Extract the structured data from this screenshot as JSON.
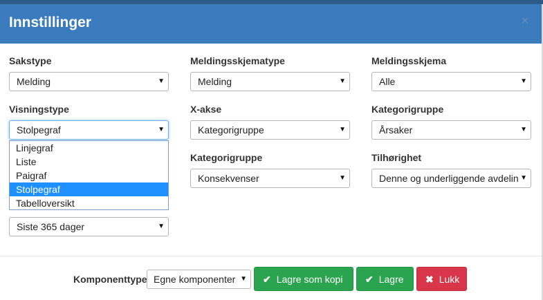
{
  "header": {
    "title": "Innstillinger",
    "close_label": "×"
  },
  "fields": {
    "sakstype": {
      "label": "Sakstype",
      "value": "Melding"
    },
    "meldingsskjematype": {
      "label": "Meldingsskjematype",
      "value": "Melding"
    },
    "meldingsskjema": {
      "label": "Meldingsskjema",
      "value": "Alle"
    },
    "visningstype": {
      "label": "Visningstype",
      "value": "Stolpegraf",
      "options": [
        "Linjegraf",
        "Liste",
        "Paigraf",
        "Stolpegraf",
        "Tabelloversikt"
      ]
    },
    "xakse": {
      "label": "X-akse",
      "value": "Kategorigruppe"
    },
    "kategorigruppe1": {
      "label": "Kategorigruppe",
      "value": "Årsaker"
    },
    "kategorigruppe2": {
      "label": "Kategorigruppe",
      "value": "Konsekvenser"
    },
    "tilhorighet": {
      "label": "Tilhørighet",
      "value": "Denne og underliggende avdelin"
    },
    "periode": {
      "value": "Siste 365 dager"
    }
  },
  "footer": {
    "komponenttype_label": "Komponenttype",
    "komponenttype_value": "Egne komponenter",
    "save_copy_label": "Lagre som kopi",
    "save_label": "Lagre",
    "close_label": "Lukk"
  },
  "icons": {
    "caret": "▼",
    "check": "✔",
    "cross": "✖"
  },
  "colors": {
    "header": "#3a7bbd",
    "green": "#2aa44f",
    "red": "#d9364a",
    "selected_option": "#1e90ff"
  }
}
